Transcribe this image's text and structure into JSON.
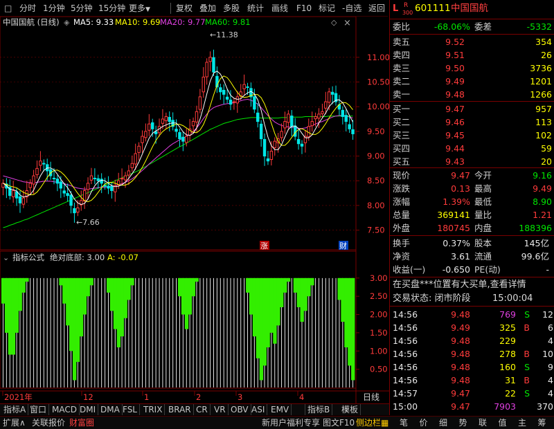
{
  "toolbar": {
    "items": [
      "分时",
      "1分钟",
      "5分钟",
      "15分钟",
      "更多"
    ],
    "right_items": [
      "复权",
      "叠加",
      "多股",
      "统计",
      "画线",
      "F10",
      "标记",
      "-自选",
      "返回"
    ]
  },
  "chart": {
    "title": "中国国航 (日线)",
    "ma5": "MA5: 9.33",
    "ma10": "MA10: 9.69",
    "ma20": "MA20: 9.77",
    "ma60": "MA60: 9.81",
    "high_mark": "11.38",
    "low_mark": "7.66",
    "badge_zhang": "涨",
    "badge_cai": "财",
    "indicator_name": "指标公式",
    "indicator_label": "绝对底部: 3.00",
    "indicator_a": "A: -0.07",
    "date_labels": [
      "2021年",
      "12",
      "1",
      "2",
      "3",
      "4"
    ],
    "day_label": "日线"
  },
  "chart_data": [
    {
      "type": "candlestick",
      "title": "中国国航 (日线)",
      "ylim": [
        7.2,
        11.6
      ],
      "yticks": [
        "11.00",
        "10.50",
        "10.00",
        "9.50",
        "9.00",
        "8.50",
        "8.00",
        "7.50"
      ],
      "ytick_values": [
        11.0,
        10.5,
        10.0,
        9.5,
        9.0,
        8.5,
        8.0,
        7.5
      ],
      "xlabels": [
        "2021年",
        "12",
        "1",
        "2",
        "3",
        "4"
      ],
      "close": [
        8.45,
        8.35,
        8.2,
        8.3,
        8.15,
        8.05,
        8.15,
        8.3,
        8.45,
        8.6,
        8.75,
        8.9,
        8.85,
        8.7,
        8.6,
        8.55,
        8.45,
        8.35,
        8.25,
        8.2,
        8.0,
        7.85,
        7.95,
        8.1,
        8.3,
        8.45,
        8.6,
        8.55,
        8.5,
        8.45,
        8.4,
        8.35,
        8.3,
        8.4,
        8.5,
        8.55,
        8.6,
        8.7,
        8.85,
        9.05,
        9.2,
        9.4,
        9.5,
        9.65,
        9.55,
        9.45,
        9.6,
        9.75,
        9.8,
        9.7,
        9.6,
        9.5,
        9.35,
        9.3,
        9.4,
        9.55,
        9.7,
        9.9,
        10.2,
        10.6,
        10.9,
        11.0,
        10.7,
        10.4,
        10.3,
        10.25,
        10.15,
        10.05,
        10.1,
        10.2,
        10.3,
        10.45,
        10.4,
        10.2,
        9.95,
        9.7,
        9.35,
        9.0,
        8.9,
        9.1,
        9.3,
        9.35,
        9.5,
        9.7,
        9.85,
        9.6,
        9.4,
        9.25,
        9.2,
        9.4,
        9.6,
        9.7,
        9.8,
        9.85,
        9.9,
        10.1,
        10.3,
        10.25,
        10.1,
        9.95,
        9.8,
        9.7,
        9.55,
        9.45
      ],
      "ma5": [
        8.45,
        8.4,
        8.33,
        8.32,
        8.29,
        8.21,
        8.17,
        8.19,
        8.22,
        8.31,
        8.46,
        8.6,
        8.71,
        8.76,
        8.76,
        8.72,
        8.63,
        8.53,
        8.44,
        8.36,
        8.25,
        8.13,
        8.05,
        8.02,
        8.04,
        8.13,
        8.28,
        8.4,
        8.48,
        8.51,
        8.5,
        8.45,
        8.4,
        8.38,
        8.39,
        8.42,
        8.47,
        8.55,
        8.64,
        8.75,
        8.88,
        9.04,
        9.2,
        9.36,
        9.46,
        9.51,
        9.55,
        9.6,
        9.63,
        9.66,
        9.67,
        9.67,
        9.59,
        9.49,
        9.43,
        9.42,
        9.46,
        9.57,
        9.75,
        9.99,
        10.26,
        10.52,
        10.68,
        10.72,
        10.66,
        10.53,
        10.36,
        10.23,
        10.17,
        10.15,
        10.16,
        10.23,
        10.28,
        10.31,
        10.26,
        10.14,
        9.93,
        9.64,
        9.38,
        9.21,
        9.13,
        9.13,
        9.23,
        9.39,
        9.54,
        9.6,
        9.61,
        9.56,
        9.46,
        9.37,
        9.37,
        9.43,
        9.55,
        9.67,
        9.77,
        9.87,
        10.0,
        10.08,
        10.13,
        10.14,
        10.08,
        9.96,
        9.82,
        9.69
      ],
      "ma20": [
        8.6,
        8.58,
        8.56,
        8.54,
        8.52,
        8.5,
        8.48,
        8.47,
        8.46,
        8.46,
        8.47,
        8.48,
        8.49,
        8.49,
        8.49,
        8.48,
        8.47,
        8.46,
        8.44,
        8.42,
        8.4,
        8.37,
        8.35,
        8.34,
        8.33,
        8.33,
        8.34,
        8.35,
        8.36,
        8.37,
        8.37,
        8.38,
        8.39,
        8.4,
        8.42,
        8.44,
        8.47,
        8.5,
        8.54,
        8.59,
        8.65,
        8.71,
        8.77,
        8.84,
        8.9,
        8.96,
        9.02,
        9.08,
        9.14,
        9.2,
        9.25,
        9.29,
        9.33,
        9.36,
        9.4,
        9.45,
        9.5,
        9.57,
        9.66,
        9.76,
        9.85,
        9.93,
        9.98,
        10.01,
        10.03,
        10.05,
        10.06,
        10.07,
        10.08,
        10.1,
        10.12,
        10.14,
        10.15,
        10.13,
        10.1,
        10.05,
        9.98,
        9.9,
        9.82,
        9.75,
        9.69,
        9.65,
        9.62,
        9.6,
        9.59,
        9.58,
        9.57,
        9.56,
        9.56,
        9.57,
        9.59,
        9.62,
        9.65,
        9.68,
        9.7,
        9.73,
        9.76,
        9.79,
        9.81,
        9.82,
        9.82,
        9.81,
        9.79,
        9.77
      ],
      "ma60": [
        7.55,
        7.57,
        7.6,
        7.62,
        7.65,
        7.67,
        7.7,
        7.72,
        7.75,
        7.78,
        7.81,
        7.84,
        7.87,
        7.9,
        7.93,
        7.96,
        7.99,
        8.02,
        8.05,
        8.08,
        8.11,
        8.14,
        8.17,
        8.2,
        8.23,
        8.26,
        8.29,
        8.32,
        8.35,
        8.38,
        8.41,
        8.44,
        8.47,
        8.5,
        8.53,
        8.56,
        8.59,
        8.62,
        8.65,
        8.68,
        8.71,
        8.75,
        8.79,
        8.83,
        8.87,
        8.91,
        8.95,
        8.99,
        9.03,
        9.07,
        9.11,
        9.15,
        9.19,
        9.22,
        9.26,
        9.3,
        9.34,
        9.38,
        9.42,
        9.46,
        9.5,
        9.54,
        9.57,
        9.6,
        9.63,
        9.66,
        9.68,
        9.7,
        9.72,
        9.74,
        9.75,
        9.76,
        9.77,
        9.78,
        9.78,
        9.78,
        9.77,
        9.77,
        9.77,
        9.77,
        9.77,
        9.77,
        9.78,
        9.78,
        9.78,
        9.79,
        9.79,
        9.79,
        9.79,
        9.8,
        9.8,
        9.8,
        9.8,
        9.8,
        9.8,
        9.8,
        9.81,
        9.81,
        9.81,
        9.81,
        9.81,
        9.81,
        9.81,
        9.81
      ]
    },
    {
      "type": "bar",
      "title": "指标公式 绝对底部",
      "ylim": [
        0,
        3.3
      ],
      "yticks": [
        "3.00",
        "2.50",
        "2.00",
        "1.50",
        "1.00",
        "0.50"
      ],
      "ytick_values": [
        3.0,
        2.5,
        2.0,
        1.5,
        1.0,
        0.5
      ],
      "values": [
        3.0,
        2.3,
        1.5,
        0.9,
        1.5,
        2.1,
        2.6,
        2.9,
        3.0,
        3.0,
        3.0,
        3.0,
        3.0,
        3.0,
        3.0,
        3.0,
        3.0,
        2.8,
        2.3,
        1.7,
        1.0,
        0.2,
        0.7,
        1.4,
        2.0,
        2.5,
        2.8,
        3.0,
        3.0,
        3.0,
        3.0,
        2.6,
        2.1,
        1.6,
        1.1,
        1.4,
        1.9,
        2.4,
        2.8,
        3.0,
        3.0,
        3.0,
        3.0,
        3.0,
        3.0,
        3.0,
        3.0,
        3.0,
        3.0,
        3.0,
        3.0,
        3.0,
        2.5,
        2.0,
        1.6,
        2.0,
        2.5,
        2.9,
        3.0,
        3.0,
        3.0,
        3.0,
        3.0,
        3.0,
        3.0,
        3.0,
        3.0,
        3.0,
        3.0,
        3.0,
        3.0,
        3.0,
        2.6,
        2.0,
        1.4,
        0.8,
        0.2,
        0.6,
        1.1,
        1.5,
        1.2,
        1.7,
        2.2,
        2.6,
        2.9,
        3.0,
        2.6,
        2.2,
        1.8,
        2.1,
        2.5,
        2.8,
        3.0,
        3.0,
        3.0,
        3.0,
        3.0,
        3.0,
        3.0,
        2.4,
        1.8,
        1.1,
        0.6,
        0.2
      ],
      "green_values": [
        2.3,
        1.5,
        0.9,
        1.5,
        2.1,
        2.6,
        2.9,
        3.0,
        3.0,
        3.0,
        3.0,
        3.0,
        3.0,
        3.0,
        3.0,
        3.0,
        3.0,
        2.8,
        2.3,
        1.7,
        1.0,
        0.2,
        0.7,
        1.4,
        2.0,
        2.5,
        2.8,
        3.0,
        3.0,
        3.0,
        3.0,
        2.6,
        2.1,
        1.6,
        1.1,
        1.4,
        1.9,
        2.4,
        2.8,
        3.0,
        3.0,
        3.0,
        3.0,
        3.0,
        3.0,
        3.0,
        3.0,
        3.0,
        3.0,
        3.0,
        3.0,
        3.0,
        2.5,
        2.0,
        1.6,
        2.0,
        2.5,
        2.9,
        3.0,
        3.0,
        3.0,
        3.0,
        3.0,
        3.0,
        3.0,
        3.0,
        3.0,
        3.0,
        3.0,
        3.0,
        3.0,
        3.0,
        2.6,
        2.0,
        1.4,
        0.8,
        0.2,
        0.6,
        1.1,
        1.5,
        1.2,
        1.7,
        2.2,
        2.6,
        2.9,
        3.0,
        2.6,
        2.2,
        1.8,
        2.1,
        2.5,
        2.8,
        3.0,
        3.0,
        3.0,
        3.0,
        3.0,
        3.0,
        3.0,
        2.4,
        1.8,
        1.1,
        0.6,
        0.2,
        0.2
      ]
    }
  ],
  "quote": {
    "L": "L",
    "R": "R",
    "num300": "300",
    "code": "601111",
    "name": "中国国航",
    "weibi_label": "委比",
    "weibi_value": "-68.06%",
    "weicha_label": "委差",
    "weicha_value": "-5332",
    "asks": [
      {
        "label": "卖五",
        "price": "9.52",
        "vol": "354"
      },
      {
        "label": "卖四",
        "price": "9.51",
        "vol": "26"
      },
      {
        "label": "卖三",
        "price": "9.50",
        "vol": "3736"
      },
      {
        "label": "卖二",
        "price": "9.49",
        "vol": "1201"
      },
      {
        "label": "卖一",
        "price": "9.48",
        "vol": "1266"
      }
    ],
    "bids": [
      {
        "label": "买一",
        "price": "9.47",
        "vol": "957"
      },
      {
        "label": "买二",
        "price": "9.46",
        "vol": "113"
      },
      {
        "label": "买三",
        "price": "9.45",
        "vol": "102"
      },
      {
        "label": "买四",
        "price": "9.44",
        "vol": "59"
      },
      {
        "label": "买五",
        "price": "9.43",
        "vol": "20"
      }
    ],
    "stats": [
      {
        "l1": "现价",
        "v1": "9.47",
        "c1": "red",
        "l2": "今开",
        "v2": "9.16",
        "c2": "green"
      },
      {
        "l1": "涨跌",
        "v1": "0.13",
        "c1": "red",
        "l2": "最高",
        "v2": "9.49",
        "c2": "red"
      },
      {
        "l1": "涨幅",
        "v1": "1.39%",
        "c1": "red",
        "l2": "最低",
        "v2": "8.90",
        "c2": "green"
      },
      {
        "l1": "总量",
        "v1": "369141",
        "c1": "yellow",
        "l2": "量比",
        "v2": "1.21",
        "c2": "red"
      },
      {
        "l1": "外盘",
        "v1": "180745",
        "c1": "red",
        "l2": "内盘",
        "v2": "188396",
        "c2": "green"
      }
    ],
    "fund": [
      {
        "l1": "换手",
        "v1": "0.37%",
        "l2": "股本",
        "v2": "145亿"
      },
      {
        "l1": "净资",
        "v1": "3.61",
        "l2": "流通",
        "v2": "99.6亿"
      },
      {
        "l1": "收益(一)",
        "v1": "-0.650",
        "l2": "PE(动)",
        "v2": "-"
      }
    ],
    "notice": "在买盘***位置有大买单,查看详情",
    "status_label": "交易状态: 闭市阶段",
    "status_time": "15:00:04",
    "ticks": [
      {
        "time": "14:56",
        "price": "9.48",
        "vol": "769",
        "vc": "purple",
        "side": "S",
        "sc": "green",
        "n": "12"
      },
      {
        "time": "14:56",
        "price": "9.49",
        "vol": "325",
        "vc": "yellow",
        "side": "B",
        "sc": "red",
        "n": "6"
      },
      {
        "time": "14:56",
        "price": "9.48",
        "vol": "229",
        "vc": "yellow",
        "side": "",
        "sc": "white",
        "n": "4"
      },
      {
        "time": "14:56",
        "price": "9.48",
        "vol": "278",
        "vc": "yellow",
        "side": "B",
        "sc": "red",
        "n": "10"
      },
      {
        "time": "14:56",
        "price": "9.48",
        "vol": "160",
        "vc": "yellow",
        "side": "S",
        "sc": "green",
        "n": "9"
      },
      {
        "time": "14:56",
        "price": "9.48",
        "vol": "31",
        "vc": "yellow",
        "side": "B",
        "sc": "red",
        "n": "4"
      },
      {
        "time": "14:57",
        "price": "9.47",
        "vol": "22",
        "vc": "yellow",
        "side": "S",
        "sc": "green",
        "n": "4"
      },
      {
        "time": "15:00",
        "price": "9.47",
        "vol": "7903",
        "vc": "purple",
        "side": "",
        "sc": "white",
        "n": "370"
      }
    ]
  },
  "tabs1": [
    "指标A",
    "窗口",
    "MACD",
    "DMI",
    "DMA",
    "FSL",
    "TRIX",
    "BRAR",
    "CR",
    "VR",
    "OBV",
    "ASI",
    "EMV",
    "指标B",
    "模板"
  ],
  "tabs2": {
    "expand": "扩展∧",
    "related": "关联报价",
    "caifu": "财富圈",
    "promo": "新用户福利专享",
    "f10": "图文F10",
    "side": "侧边栏",
    "right": [
      "笔",
      "价",
      "细",
      "势",
      "联",
      "值",
      "主",
      "筹"
    ]
  },
  "colors": {
    "up": "#ff3b3b",
    "down": "#00e6e6",
    "ma5": "#ffffff",
    "ma10": "#ffff00",
    "ma20": "#e040e0",
    "ma60": "#00e600",
    "grid": "#7a0000"
  }
}
